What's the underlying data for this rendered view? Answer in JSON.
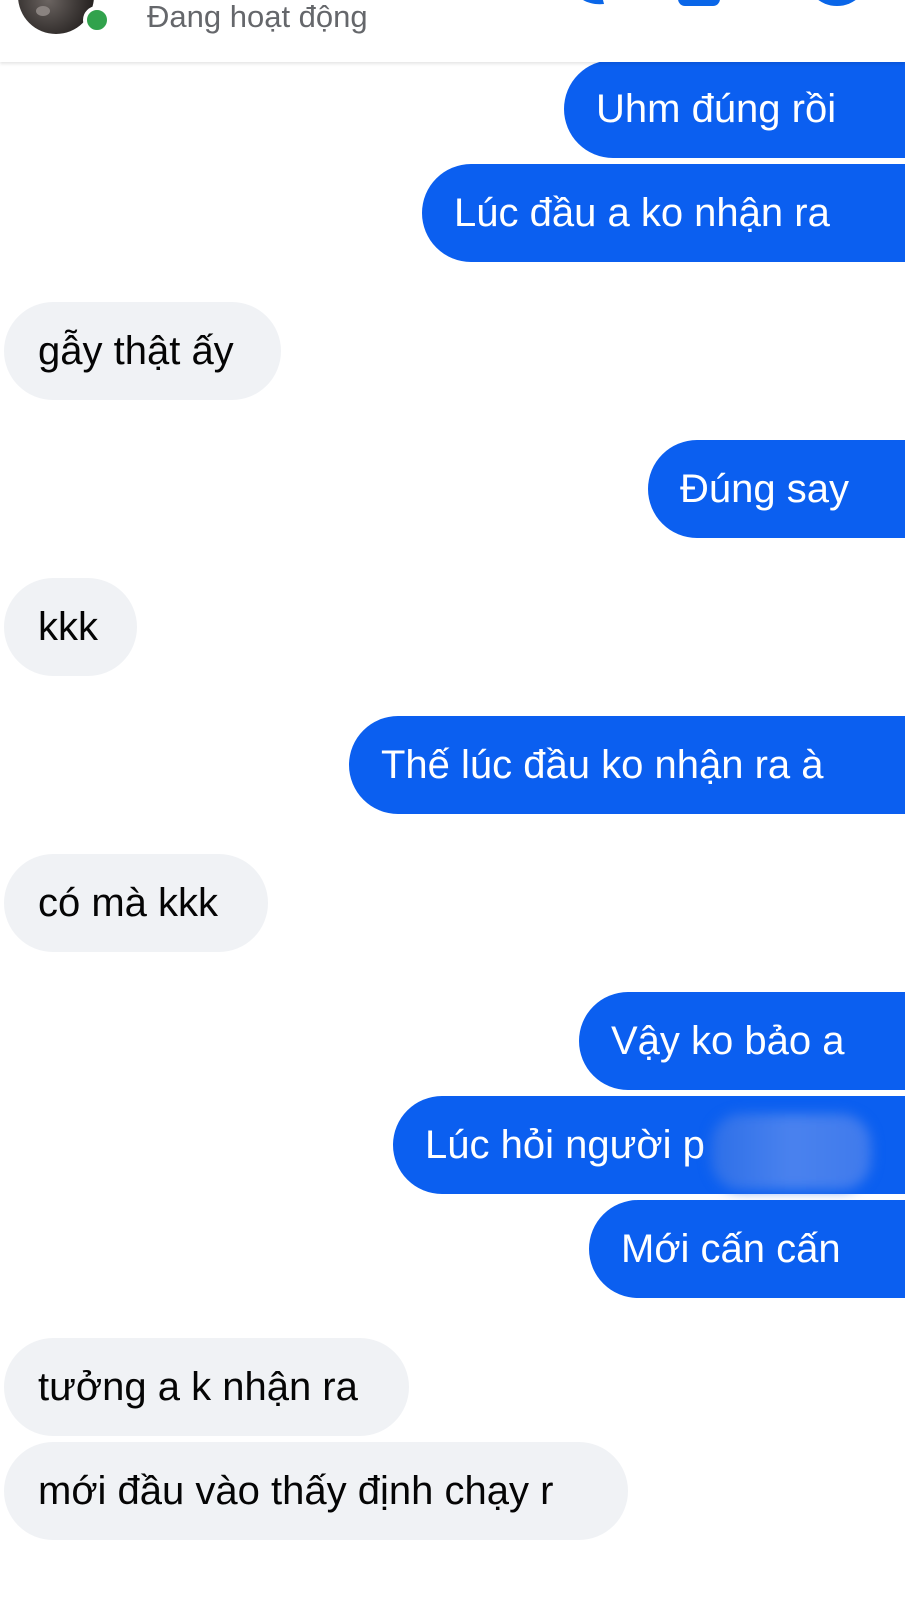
{
  "header": {
    "status": "Đang hoạt động",
    "avatar_icon": "contact-avatar",
    "online_color": "#31a24c"
  },
  "colors": {
    "sent_bubble": "#0b5ff0",
    "received_bubble": "#f0f2f5",
    "accent": "#0a66e8"
  },
  "messages": [
    {
      "direction": "sent",
      "text": "Uhm đúng rồi"
    },
    {
      "direction": "sent",
      "text": "Lúc đầu a ko nhận ra"
    },
    {
      "direction": "received",
      "text": "gẫy thật ấy"
    },
    {
      "direction": "sent",
      "text": "Đúng say"
    },
    {
      "direction": "received",
      "text": "kkk"
    },
    {
      "direction": "sent",
      "text": "Thế lúc đầu ko nhận ra à"
    },
    {
      "direction": "received",
      "text": "có mà kkk"
    },
    {
      "direction": "sent",
      "text": "Vậy ko bảo a"
    },
    {
      "direction": "sent",
      "text": "Lúc hỏi người p"
    },
    {
      "direction": "sent",
      "text": "Mới cấn cấn"
    },
    {
      "direction": "received",
      "text": "tưởng a k nhận ra"
    },
    {
      "direction": "received",
      "text": "mới đầu vào thấy định chạy r"
    }
  ]
}
